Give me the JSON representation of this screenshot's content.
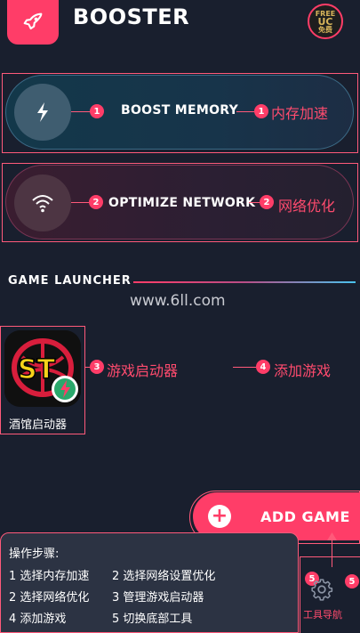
{
  "header": {
    "title": "BOOSTER",
    "badge_line1": "FREE",
    "badge_line2": "UC",
    "badge_line3": "免费"
  },
  "boost_memory": {
    "label": "BOOST MEMORY",
    "annotation": "内存加速",
    "marker_left": "1",
    "marker_right": "1"
  },
  "optimize_network": {
    "label": "OPTIMIZE NETWORK",
    "annotation": "网络优化",
    "marker_left": "2",
    "marker_right": "2"
  },
  "game_launcher": {
    "title": "GAME LAUNCHER",
    "watermark": "www.6ll.com",
    "game_name": "酒馆启动器",
    "tile_text": "ST",
    "launcher_annotation": "游戏启动器",
    "launcher_marker": "3",
    "add_annotation": "添加游戏",
    "add_marker": "4"
  },
  "add_game": {
    "label": "ADD GAME",
    "plus": "+"
  },
  "steps": {
    "title": "操作步骤:",
    "rows": [
      [
        "1 选择内存加速",
        "2 选择网络设置优化"
      ],
      [
        "2 选择网络优化",
        "3 管理游戏启动器"
      ],
      [
        "4 添加游戏",
        "5 切换底部工具"
      ]
    ]
  },
  "tool_nav": {
    "label": "工具导航",
    "marker_left": "5",
    "marker_right": "5"
  },
  "colors": {
    "accent": "#ff3d68",
    "background": "#191f2e"
  }
}
